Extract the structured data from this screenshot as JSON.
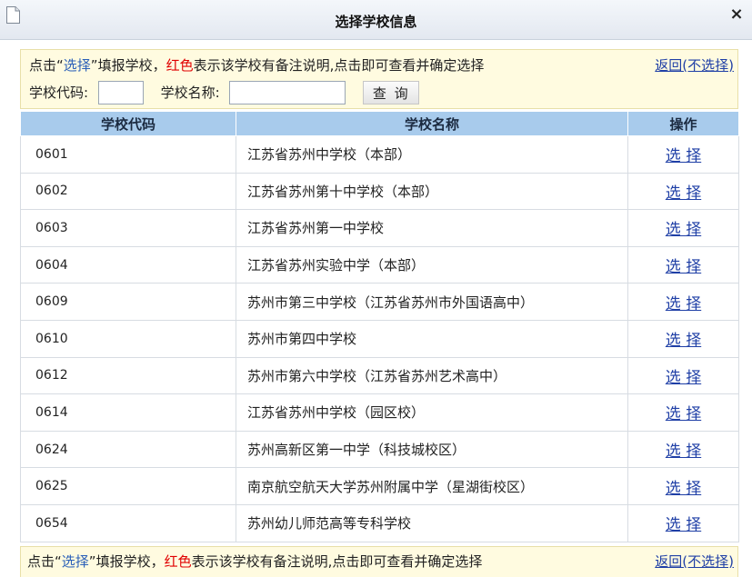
{
  "dialog": {
    "title": "选择学校信息",
    "close_label": "×"
  },
  "notice": {
    "p1": "点击“",
    "choose_word": "选择",
    "p2": "”填报学校，",
    "red_word": "红色",
    "p3": "表示该学校有备注说明,点击即可查看并确定选择",
    "back_link": "返回(不选择)"
  },
  "search": {
    "code_label": "学校代码:",
    "name_label": "学校名称:",
    "code_value": "",
    "name_value": "",
    "button_label": "查 询"
  },
  "table": {
    "headers": [
      "学校代码",
      "学校名称",
      "操作"
    ],
    "rows": [
      {
        "code": "0601",
        "name": "江苏省苏州中学校（本部）",
        "action": "选 择"
      },
      {
        "code": "0602",
        "name": "江苏省苏州第十中学校（本部）",
        "action": "选 择"
      },
      {
        "code": "0603",
        "name": "江苏省苏州第一中学校",
        "action": "选 择"
      },
      {
        "code": "0604",
        "name": "江苏省苏州实验中学（本部）",
        "action": "选 择"
      },
      {
        "code": "0609",
        "name": "苏州市第三中学校（江苏省苏州市外国语高中）",
        "action": "选 择"
      },
      {
        "code": "0610",
        "name": "苏州市第四中学校",
        "action": "选 择"
      },
      {
        "code": "0612",
        "name": "苏州市第六中学校（江苏省苏州艺术高中）",
        "action": "选 择"
      },
      {
        "code": "0614",
        "name": "江苏省苏州中学校（园区校）",
        "action": "选 择"
      },
      {
        "code": "0624",
        "name": "苏州高新区第一中学（科技城校区）",
        "action": "选 择"
      },
      {
        "code": "0625",
        "name": "南京航空航天大学苏州附属中学（星湖街校区）",
        "action": "选 择"
      },
      {
        "code": "0654",
        "name": "苏州幼儿师范高等专科学校",
        "action": "选 择"
      }
    ]
  },
  "colors": {
    "header_bg": "#a8cbec",
    "notice_bg": "#fffbe0",
    "link": "#1f3fa6",
    "red": "#e00000"
  },
  "icons": {
    "title_icon": "document-icon",
    "close_icon": "close-icon"
  }
}
